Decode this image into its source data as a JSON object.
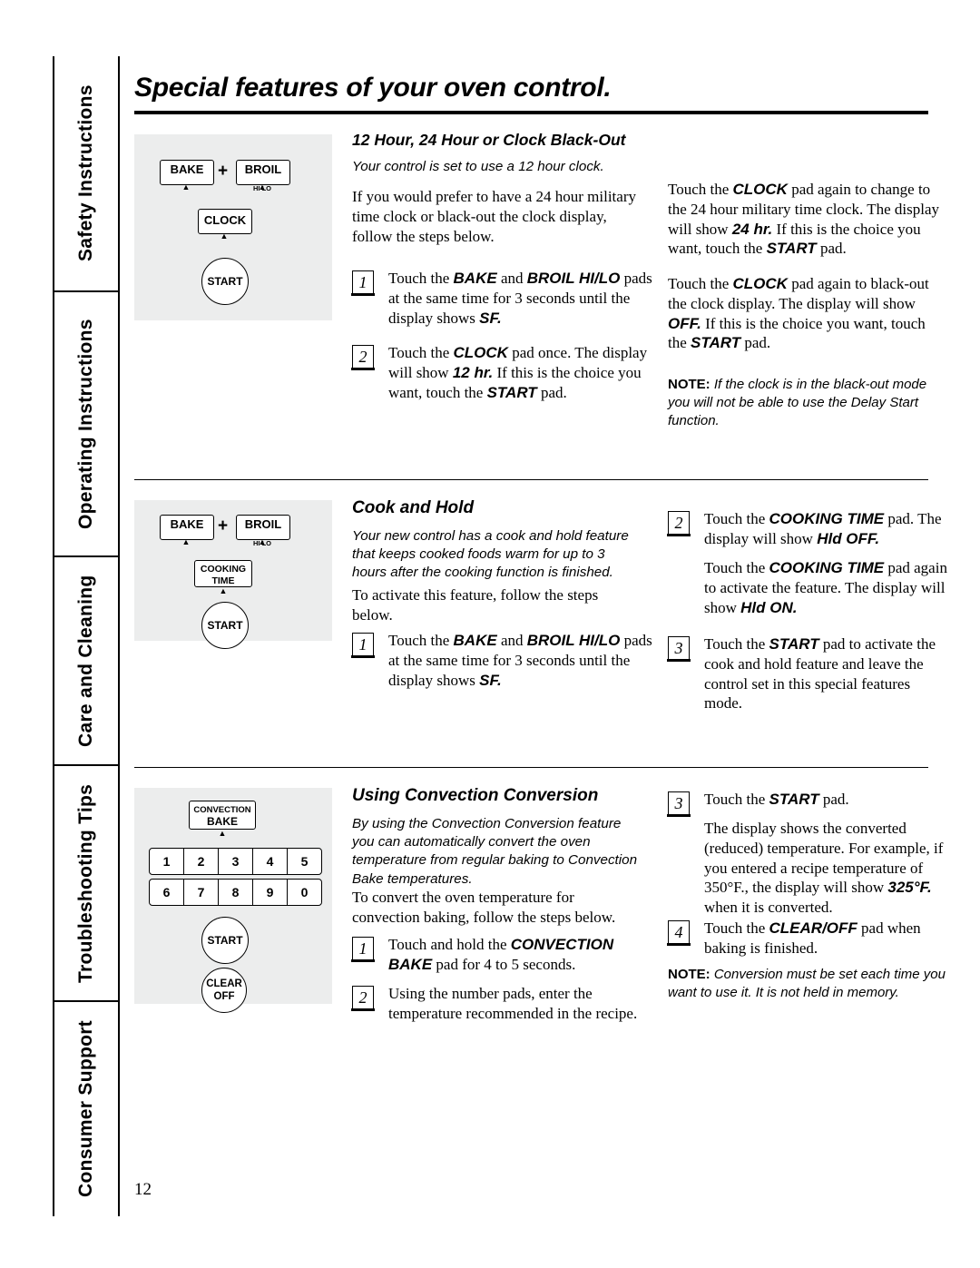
{
  "page": {
    "number": "12"
  },
  "sidebar": {
    "items": [
      {
        "label": "Safety Instructions"
      },
      {
        "label": "Operating Instructions"
      },
      {
        "label": "Care and Cleaning"
      },
      {
        "label": "Troubleshooting Tips"
      },
      {
        "label": "Consumer Support"
      }
    ]
  },
  "header": {
    "title": "Special features of your oven control."
  },
  "sections": [
    {
      "id": "blackout",
      "heading": "12 Hour, 24 Hour or Clock Black-Out",
      "intro_italic": "Your control is set to use a 12 hour clock.",
      "paragraph": "If you would prefer to have a 24 hour military time clock or black-out the clock display, follow the steps below.",
      "steps": [
        {
          "num": "1",
          "text_pre": "Touch the ",
          "bold1": "BAKE",
          "mid": " and ",
          "bold2": "BROIL HI/LO",
          "text_post": " pads at the same time for 3 seconds until the display shows ",
          "bold3": "SF.",
          "tail": ""
        },
        {
          "num": "2",
          "text_pre": "Touch the ",
          "bold1": "CLOCK",
          "mid": " pad once. The display will show ",
          "bold2": "12 hr.",
          "text_post": " If this is the choice you want, touch the ",
          "bold3": "START",
          "tail": " pad."
        }
      ],
      "right_paragraphs": [
        {
          "pre": "Touch the ",
          "b1": "CLOCK",
          "mid": " pad again to change to the 24 hour military time clock. The display will show ",
          "b2": "24 hr.",
          "mid2": " If this is the choice you want, touch the ",
          "b3": "START",
          "post": " pad."
        },
        {
          "pre": "Touch the ",
          "b1": "CLOCK",
          "mid": " pad again to black-out the clock display. The display will show ",
          "b2": "OFF.",
          "mid2": " If this is the choice you want, touch the ",
          "b3": "START",
          "post": " pad."
        }
      ],
      "note": {
        "label": "NOTE:",
        "text": " If the clock is in the black-out mode you will not be able to use the Delay Start function."
      },
      "pads": {
        "bake": "BAKE",
        "plus": "+",
        "broil": "BROIL",
        "broil_sub": "HI       LO",
        "clock": "CLOCK",
        "start": "START"
      }
    },
    {
      "id": "cookhold",
      "heading": "Cook and Hold",
      "intro_italic": "Your new control has a cook and hold feature that keeps cooked foods warm for up to 3 hours after the cooking function is finished.",
      "paragraph": "To activate this feature, follow the steps below.",
      "steps": [
        {
          "num": "1",
          "text_pre": "Touch the ",
          "bold1": "BAKE",
          "mid": " and ",
          "bold2": "BROIL HI/LO",
          "text_post": " pads at the same time for 3 seconds until the display shows ",
          "bold3": "SF.",
          "tail": ""
        }
      ],
      "right_steps": [
        {
          "num": "2",
          "pre": "Touch the ",
          "b1": "COOKING TIME",
          "mid": " pad. The display will show ",
          "b2": "Hld OFF.",
          "post": ""
        },
        {
          "num": "",
          "pre": "Touch the ",
          "b1": "COOKING TIME",
          "mid": " pad again to activate the feature. The display will show ",
          "b2": "Hld ON.",
          "post": ""
        },
        {
          "num": "3",
          "pre": "Touch the ",
          "b1": "START",
          "mid": " pad to activate the cook and hold feature and leave the control set in this special features mode.",
          "b2": "",
          "post": ""
        }
      ],
      "pads": {
        "bake": "BAKE",
        "plus": "+",
        "broil": "BROIL",
        "broil_sub": "HI       LO",
        "cooking_time_l1": "COOKING",
        "cooking_time_l2": "TIME",
        "start": "START"
      }
    },
    {
      "id": "convection",
      "heading": "Using Convection Conversion",
      "intro_italic": "By using the Convection Conversion feature you can automatically convert the oven temperature from regular baking to Convection Bake temperatures.",
      "paragraph": "To convert the oven temperature for convection baking, follow the steps below.",
      "steps": [
        {
          "num": "1",
          "text_pre": "Touch and hold the ",
          "bold1": "CONVECTION BAKE",
          "mid": " pad for 4 to 5 seconds.",
          "bold2": "",
          "text_post": "",
          "bold3": "",
          "tail": ""
        },
        {
          "num": "2",
          "text_pre": "Using the number pads, enter the temperature recommended in the recipe.",
          "bold1": "",
          "mid": "",
          "bold2": "",
          "text_post": "",
          "bold3": "",
          "tail": ""
        }
      ],
      "right_steps": [
        {
          "num": "3",
          "pre": "Touch the ",
          "b1": "START",
          "mid": " pad.",
          "b2": "",
          "post": ""
        },
        {
          "num": "",
          "pre": "The display shows the converted (reduced) temperature. For example, if you entered a recipe temperature of 350°F., the display will show ",
          "b1": "325°F.",
          "mid": " when it is converted.",
          "b2": "",
          "post": ""
        },
        {
          "num": "4",
          "pre": "Touch the ",
          "b1": "CLEAR/OFF",
          "mid": " pad when baking is finished.",
          "b2": "",
          "post": ""
        }
      ],
      "note": {
        "label": "NOTE:",
        "text": " Conversion must be set each time you want to use it. It is not held in memory."
      },
      "pads": {
        "convection_l1": "CONVECTION",
        "convection_l2": "BAKE",
        "numbers_row1": [
          "1",
          "2",
          "3",
          "4",
          "5"
        ],
        "numbers_row2": [
          "6",
          "7",
          "8",
          "9",
          "0"
        ],
        "start": "START",
        "clear_l1": "CLEAR",
        "clear_l2": "OFF"
      }
    }
  ]
}
